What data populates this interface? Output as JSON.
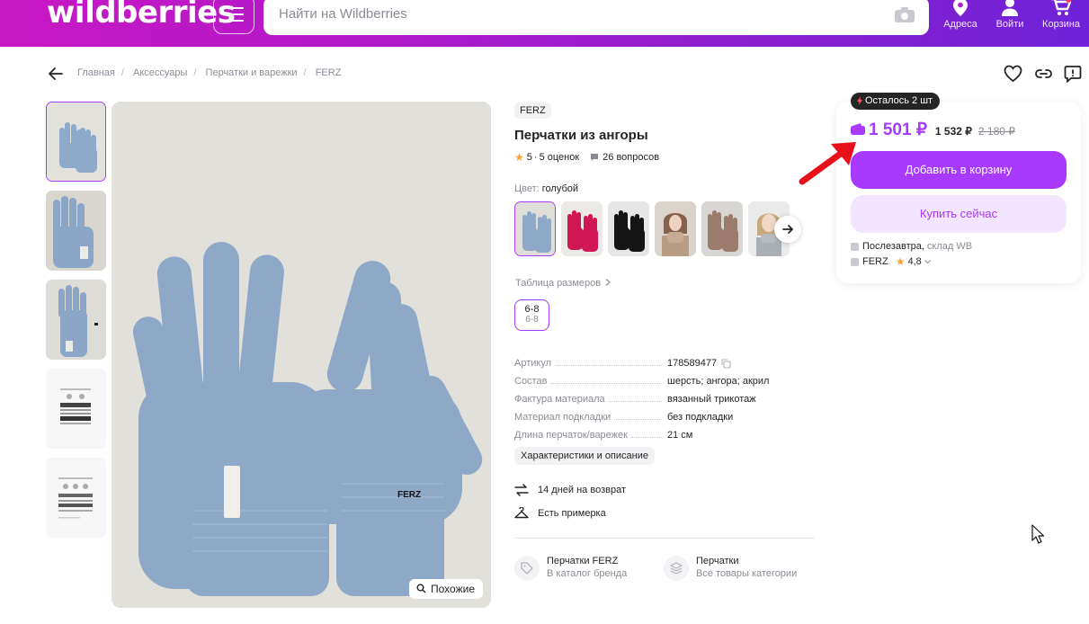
{
  "header": {
    "logo": "wildberries",
    "search_placeholder": "Найти на Wildberries",
    "addresses": "Адреса",
    "login": "Войти",
    "cart": "Корзина",
    "colors": {
      "gradient_start": "#c818c4",
      "gradient_end": "#6f22d8"
    }
  },
  "breadcrumbs": [
    "Главная",
    "Аксессуары",
    "Перчатки и варежки",
    "FERZ"
  ],
  "product": {
    "brand": "FERZ",
    "title": "Перчатки из ангоры",
    "rating": "5",
    "reviews": "5 оценок",
    "questions": "26 вопросов",
    "color_label": "Цвет:",
    "color_value": "голубой",
    "swatch_colors": [
      "голубой",
      "малиновый",
      "черный",
      "бежевый",
      "коричневый",
      "серый"
    ],
    "size_table": "Таблица размеров",
    "size": {
      "label": "6-8",
      "sub": "6-8"
    },
    "specs": [
      {
        "key": "Артикул",
        "value": "178589477"
      },
      {
        "key": "Состав",
        "value": "шерсть; ангора; акрил"
      },
      {
        "key": "Фактура материала",
        "value": "вязанный трикотаж"
      },
      {
        "key": "Материал подкладки",
        "value": "без подкладки"
      },
      {
        "key": "Длина перчаток/варежек",
        "value": "21 см"
      }
    ],
    "description_button": "Характеристики и описание",
    "return_policy": "14 дней на возврат",
    "fitting": "Есть примерка",
    "brand_catalog": {
      "title": "Перчатки FERZ",
      "subtitle": "В каталог бренда"
    },
    "category": {
      "title": "Перчатки",
      "subtitle": "Все товары категории"
    },
    "similar": "Похожие"
  },
  "purchase": {
    "stock": "Осталось 2 шт",
    "price": "1 501 ₽",
    "price_alt": "1 532 ₽",
    "price_old": "2 180 ₽",
    "add_to_cart": "Добавить в корзину",
    "buy_now": "Купить сейчас",
    "delivery_date": "Послезавтра,",
    "delivery_source": "склад WB",
    "seller": "FERZ",
    "seller_rating": "4,8",
    "accent_color": "#a73afd"
  }
}
